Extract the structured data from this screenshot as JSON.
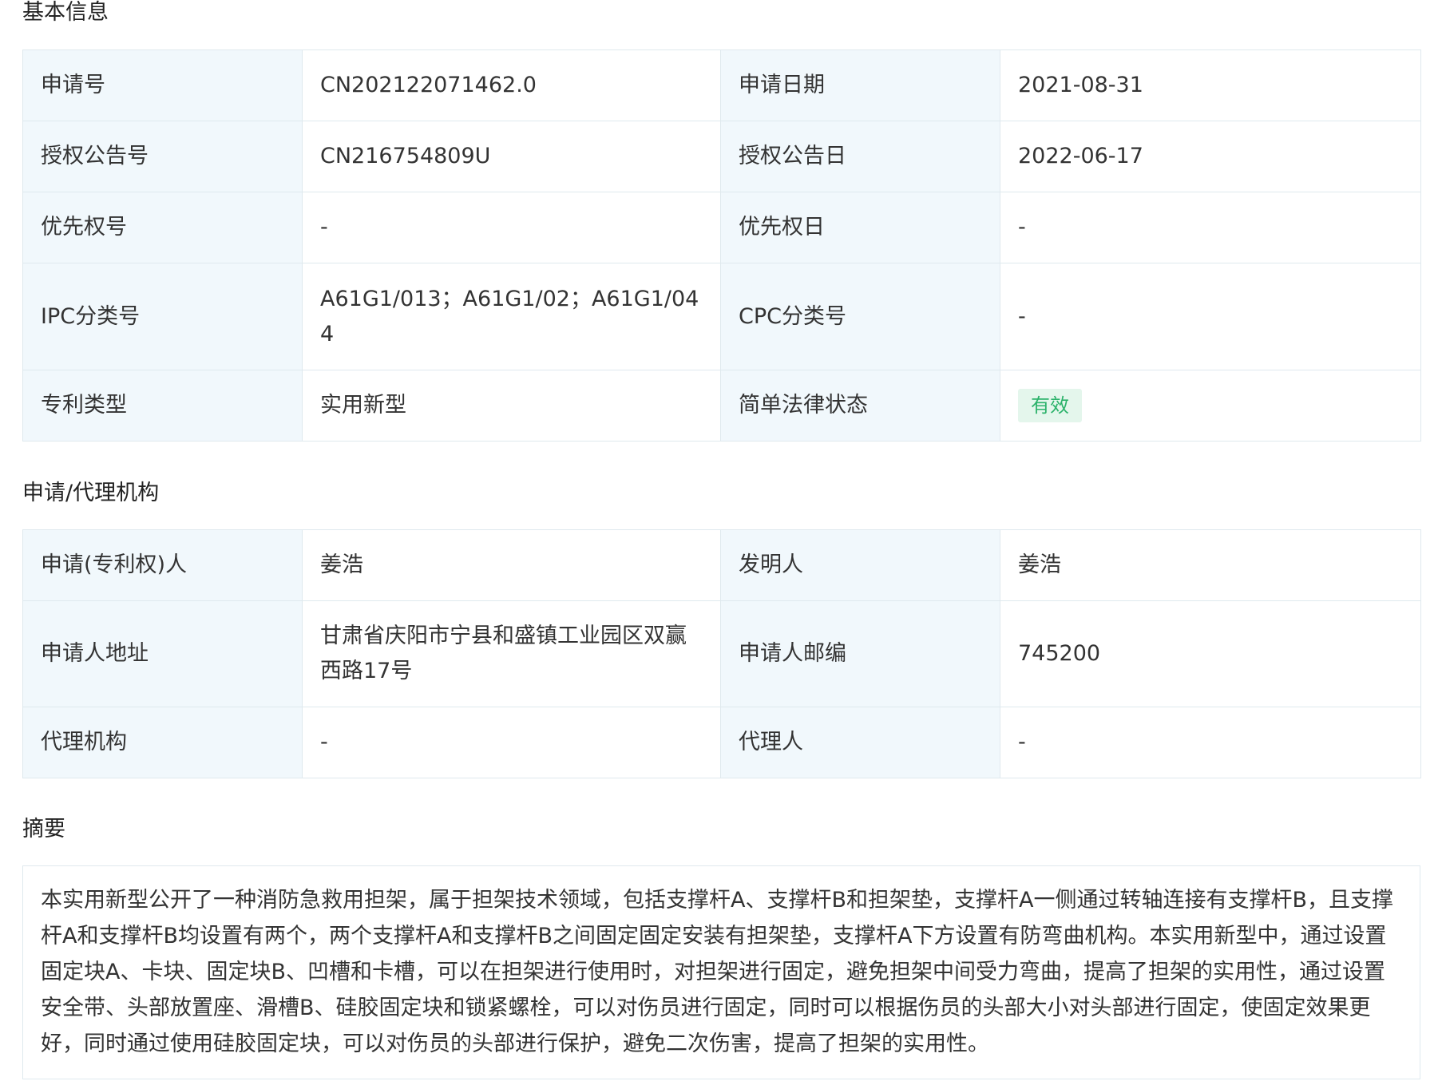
{
  "sections": {
    "basic_title": "基本信息",
    "agency_title": "申请/代理机构",
    "abstract_title": "摘要"
  },
  "basic": {
    "app_no_label": "申请号",
    "app_no": "CN202122071462.0",
    "app_date_label": "申请日期",
    "app_date": "2021-08-31",
    "grant_no_label": "授权公告号",
    "grant_no": "CN216754809U",
    "grant_date_label": "授权公告日",
    "grant_date": "2022-06-17",
    "priority_no_label": "优先权号",
    "priority_no": "-",
    "priority_date_label": "优先权日",
    "priority_date": "-",
    "ipc_label": "IPC分类号",
    "ipc": "A61G1/013；A61G1/02；A61G1/044",
    "cpc_label": "CPC分类号",
    "cpc": "-",
    "type_label": "专利类型",
    "type": "实用新型",
    "status_label": "简单法律状态",
    "status": "有效",
    "status_color": "#2bb26a"
  },
  "agency": {
    "applicant_label": "申请(专利权)人",
    "applicant": "姜浩",
    "inventor_label": "发明人",
    "inventor": "姜浩",
    "address_label": "申请人地址",
    "address": "甘肃省庆阳市宁县和盛镇工业园区双赢西路17号",
    "postcode_label": "申请人邮编",
    "postcode": "745200",
    "agency_label": "代理机构",
    "agency": "-",
    "agent_label": "代理人",
    "agent": "-"
  },
  "abstract": {
    "text": "本实用新型公开了一种消防急救用担架，属于担架技术领域，包括支撑杆A、支撑杆B和担架垫，支撑杆A一侧通过转轴连接有支撑杆B，且支撑杆A和支撑杆B均设置有两个，两个支撑杆A和支撑杆B之间固定固定安装有担架垫，支撑杆A下方设置有防弯曲机构。本实用新型中，通过设置固定块A、卡块、固定块B、凹槽和卡槽，可以在担架进行使用时，对担架进行固定，避免担架中间受力弯曲，提高了担架的实用性，通过设置安全带、头部放置座、滑槽B、硅胶固定块和锁紧螺栓，可以对伤员进行固定，同时可以根据伤员的头部大小对头部进行固定，使固定效果更好，同时通过使用硅胶固定块，可以对伤员的头部进行保护，避免二次伤害，提高了担架的实用性。"
  }
}
